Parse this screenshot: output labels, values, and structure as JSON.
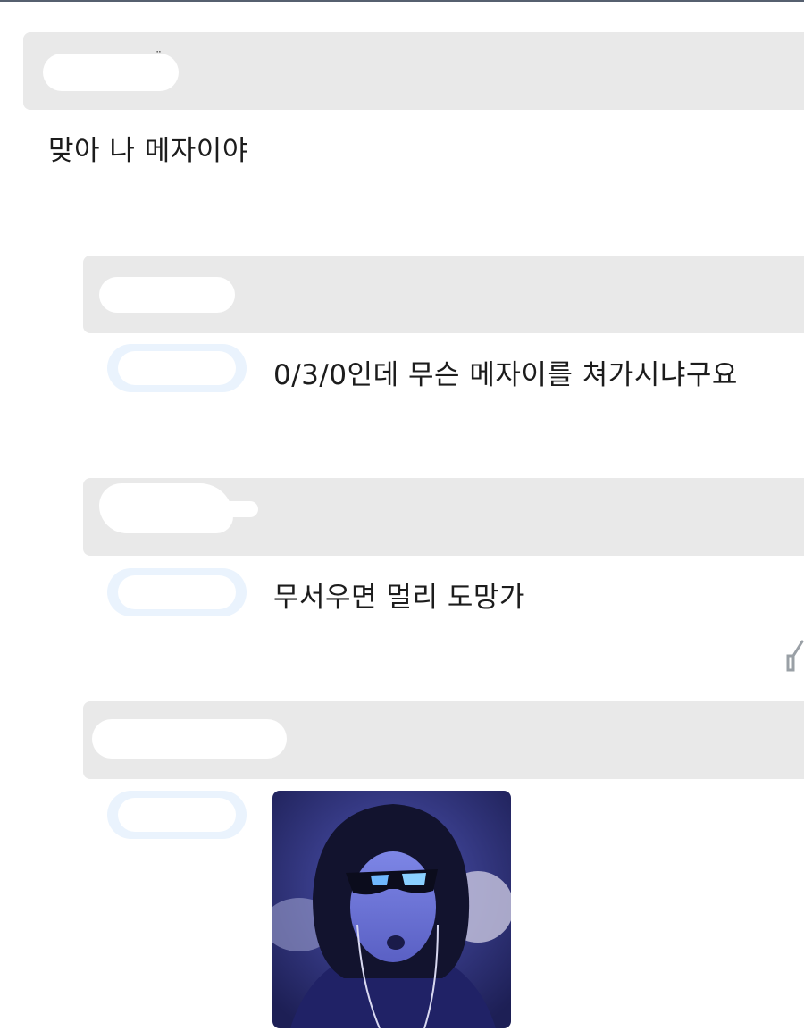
{
  "comments": [
    {
      "author": "",
      "text": "맞아 나 메자이야"
    },
    {
      "author": "",
      "reply_to": "",
      "text": "0/3/0인데 무슨 메자이를 쳐가시냐구요"
    },
    {
      "author": "",
      "reply_to": "",
      "text": "무서우면 멀리 도망가"
    },
    {
      "author": "",
      "reply_to": "",
      "image": "blue-tinted-photo-of-person-with-sunglasses"
    }
  ],
  "icons": {
    "like": "thumbs-up-icon"
  },
  "colors": {
    "name_bar": "#e9e9e9",
    "reply_tag": "#eaf3fd",
    "image_tint": "#3a3f86"
  }
}
